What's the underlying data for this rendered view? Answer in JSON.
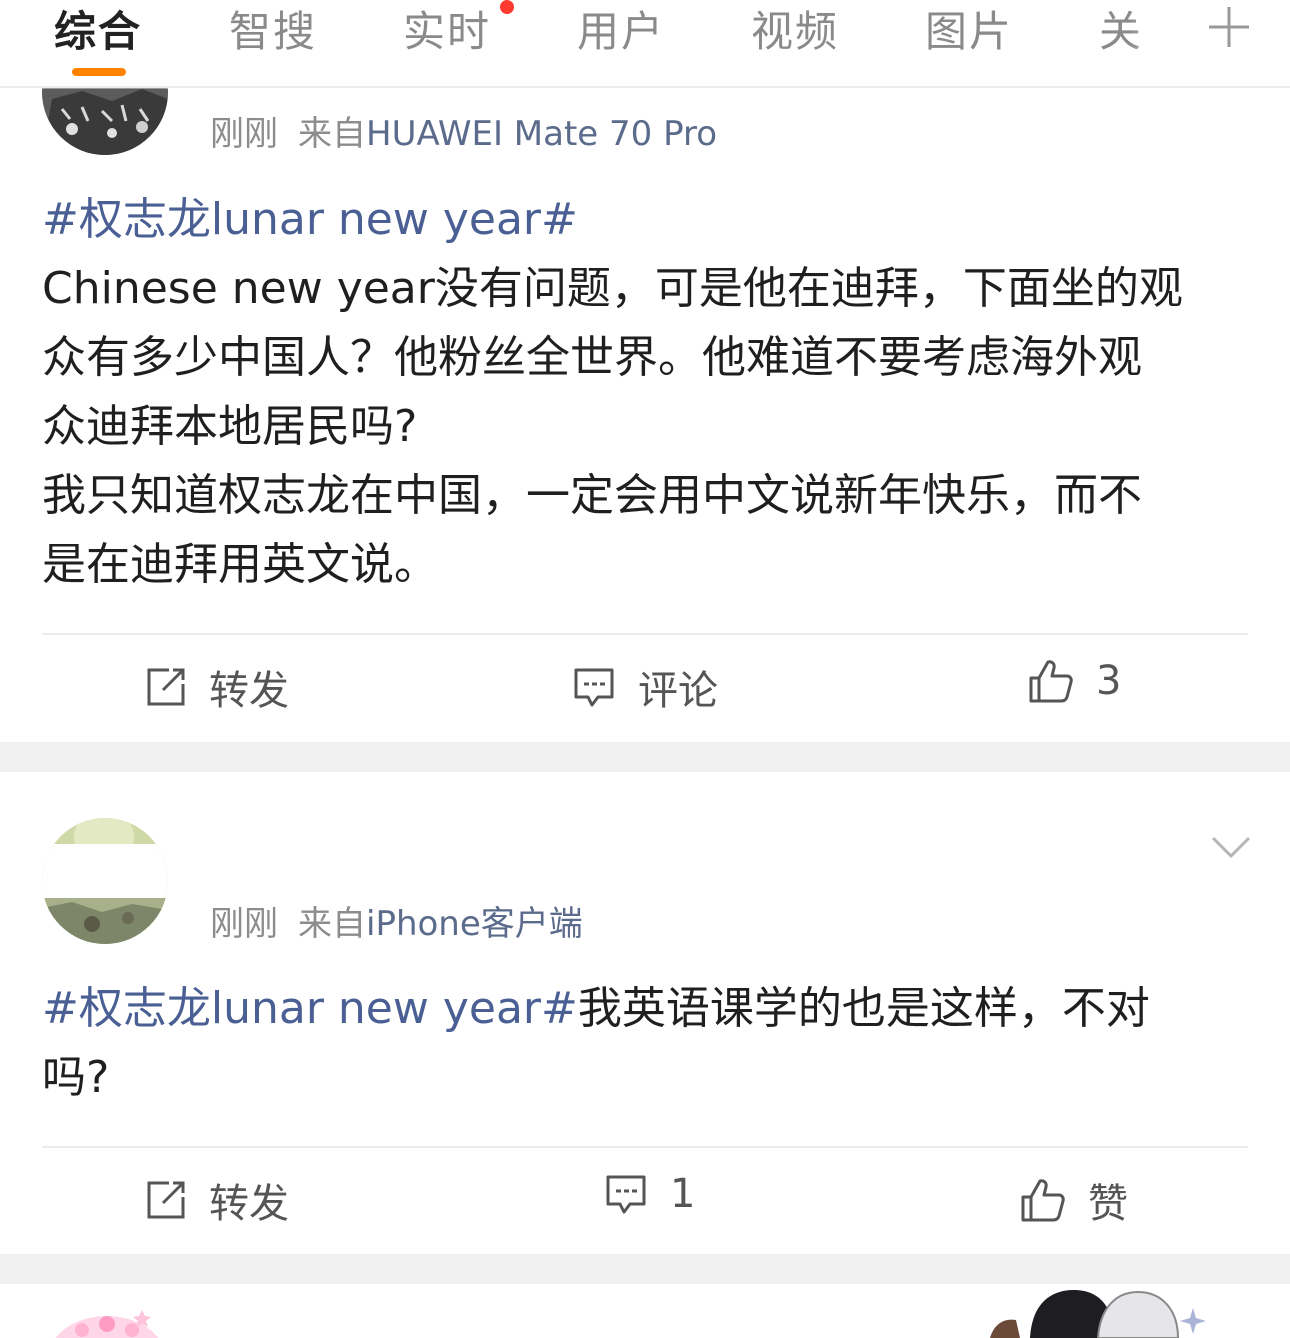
{
  "tabs": [
    {
      "label": "综合",
      "active": true
    },
    {
      "label": "智搜"
    },
    {
      "label": "实时",
      "has_dot": true
    },
    {
      "label": "用户"
    },
    {
      "label": "视频"
    },
    {
      "label": "图片"
    },
    {
      "label": "关"
    }
  ],
  "posts": [
    {
      "time": "刚刚",
      "from_prefix": "来自",
      "device": "HUAWEI Mate 70 Pro",
      "topic": "#权志龙lunar new year#",
      "body_lines": [
        "Chinese new year没有问题，可是他在迪拜，下面坐的观",
        "众有多少中国人？他粉丝全世界。他难道不要考虑海外观",
        "众迪拜本地居民吗?",
        "我只知道权志龙在中国，一定会用中文说新年快乐，而不",
        "是在迪拜用英文说。"
      ],
      "repost_label": "转发",
      "comment_label": "评论",
      "like_label": "3"
    },
    {
      "time": "刚刚",
      "from_prefix": "来自",
      "device": "iPhone客户端",
      "topic": "#权志龙lunar new year#",
      "body_inline": "我英语课学的也是这样，不对",
      "body_line2": "吗?",
      "repost_label": "转发",
      "comment_label": "1",
      "like_label": "赞"
    }
  ],
  "colors": {
    "accent": "#ff8200",
    "topic": "#4a5f93",
    "dot": "#ff3a2f"
  }
}
